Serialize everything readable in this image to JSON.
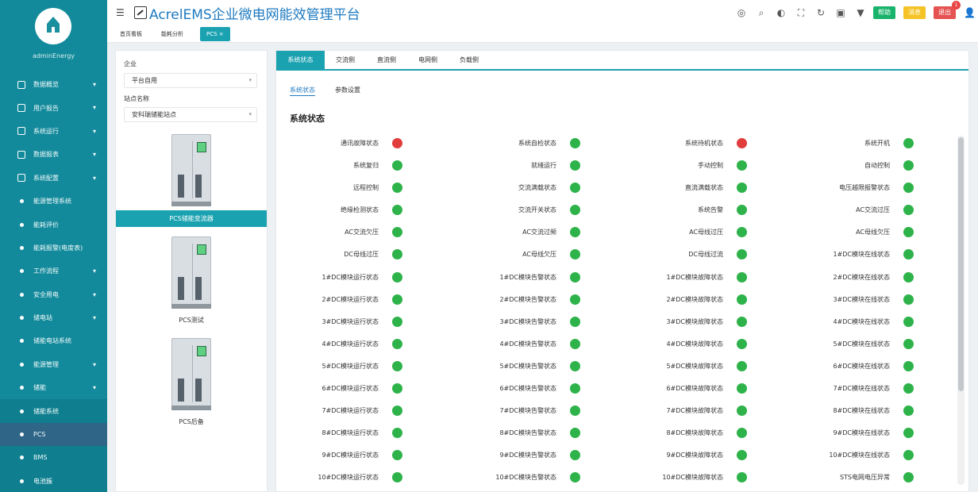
{
  "app": {
    "title": "AcrelEMS企业微电网能效管理平台"
  },
  "user": {
    "name": "adminEnergy"
  },
  "sidebar": {
    "items": [
      {
        "label": "数据概览",
        "level": 1,
        "arrow": "▾"
      },
      {
        "label": "用户报告",
        "level": 1,
        "arrow": "▾"
      },
      {
        "label": "系统运行",
        "level": 1,
        "arrow": "▾"
      },
      {
        "label": "数据报表",
        "level": 1,
        "arrow": "▾"
      },
      {
        "label": "系统配置",
        "level": 1,
        "arrow": "▾"
      },
      {
        "label": "能源管理系统",
        "level": 2,
        "arrow": ""
      },
      {
        "label": "能耗评价",
        "level": 2,
        "arrow": ""
      },
      {
        "label": "能耗报警(电度表)",
        "level": 2,
        "arrow": ""
      },
      {
        "label": "工作流程",
        "level": 2,
        "arrow": "▾"
      },
      {
        "label": "安全用电",
        "level": 2,
        "arrow": "▾"
      },
      {
        "label": "储电站",
        "level": 2,
        "arrow": "▾"
      },
      {
        "label": "储能电站系统",
        "level": 2,
        "arrow": ""
      },
      {
        "label": "能源管理",
        "level": 2,
        "arrow": "▾"
      },
      {
        "label": "储能",
        "level": 2,
        "arrow": "▾"
      },
      {
        "label": "储能系统",
        "level": 3,
        "arrow": ""
      },
      {
        "label": "PCS",
        "level": 3,
        "arrow": "",
        "active": true
      },
      {
        "label": "BMS",
        "level": 3,
        "arrow": ""
      },
      {
        "label": "电池簇",
        "level": 3,
        "arrow": ""
      }
    ]
  },
  "topbar": {
    "icons": [
      "monitor-icon",
      "search-icon",
      "volume-icon",
      "fullscreen-icon",
      "refresh-icon",
      "image-icon",
      "shirt-icon"
    ],
    "icon_glyphs": [
      "◎",
      "⌕",
      "◐",
      "⛶",
      "↻",
      "▣",
      "▼"
    ],
    "btn_green": "帮助",
    "btn_yellow": "消息",
    "btn_red": "退出",
    "badge": "1",
    "avatar_glyph": "👤"
  },
  "tabs": {
    "items": [
      "首页看板",
      "能耗分析",
      "PCS"
    ],
    "close": "×"
  },
  "left": {
    "enterprise_label": "企业",
    "enterprise_value": "平台自用",
    "station_label": "站点名称",
    "station_value": "安科瑞储能站点",
    "devices": [
      "PCS储能变流器",
      "PCS测试",
      "PCS后备"
    ]
  },
  "main": {
    "tabs": [
      "系统状态",
      "交流侧",
      "直流侧",
      "电网侧",
      "负载侧"
    ],
    "subtabs": [
      "系统状态",
      "参数设置"
    ],
    "section_title": "系统状态",
    "statuses": [
      {
        "label": "通讯故障状态",
        "status": "red"
      },
      {
        "label": "系统自检状态",
        "status": "green"
      },
      {
        "label": "系统待机状态",
        "status": "red"
      },
      {
        "label": "系统开机",
        "status": "green"
      },
      {
        "label": "系统复归",
        "status": "green"
      },
      {
        "label": "就绪运行",
        "status": "green"
      },
      {
        "label": "手动控制",
        "status": "green"
      },
      {
        "label": "自动控制",
        "status": "green"
      },
      {
        "label": "远程控制",
        "status": "green"
      },
      {
        "label": "交流满载状态",
        "status": "green"
      },
      {
        "label": "直流满载状态",
        "status": "green"
      },
      {
        "label": "电压越限报警状态",
        "status": "green"
      },
      {
        "label": "绝缘检测状态",
        "status": "green"
      },
      {
        "label": "交流开关状态",
        "status": "green"
      },
      {
        "label": "系统告警",
        "status": "green"
      },
      {
        "label": "AC交流过压",
        "status": "green"
      },
      {
        "label": "AC交流欠压",
        "status": "green"
      },
      {
        "label": "AC交流过频",
        "status": "green"
      },
      {
        "label": "AC母线过压",
        "status": "green"
      },
      {
        "label": "AC母线欠压",
        "status": "green"
      },
      {
        "label": "DC母线过压",
        "status": "green"
      },
      {
        "label": "AC母线欠压",
        "status": "green"
      },
      {
        "label": "DC母线过流",
        "status": "green"
      },
      {
        "label": "1#DC模块在线状态",
        "status": "green"
      },
      {
        "label": "1#DC模块运行状态",
        "status": "green"
      },
      {
        "label": "1#DC模块告警状态",
        "status": "green"
      },
      {
        "label": "1#DC模块故障状态",
        "status": "green"
      },
      {
        "label": "2#DC模块在线状态",
        "status": "green"
      },
      {
        "label": "2#DC模块运行状态",
        "status": "green"
      },
      {
        "label": "2#DC模块告警状态",
        "status": "green"
      },
      {
        "label": "2#DC模块故障状态",
        "status": "green"
      },
      {
        "label": "3#DC模块在线状态",
        "status": "green"
      },
      {
        "label": "3#DC模块运行状态",
        "status": "green"
      },
      {
        "label": "3#DC模块告警状态",
        "status": "green"
      },
      {
        "label": "3#DC模块故障状态",
        "status": "green"
      },
      {
        "label": "4#DC模块在线状态",
        "status": "green"
      },
      {
        "label": "4#DC模块运行状态",
        "status": "green"
      },
      {
        "label": "4#DC模块告警状态",
        "status": "green"
      },
      {
        "label": "4#DC模块故障状态",
        "status": "green"
      },
      {
        "label": "5#DC模块在线状态",
        "status": "green"
      },
      {
        "label": "5#DC模块运行状态",
        "status": "green"
      },
      {
        "label": "5#DC模块告警状态",
        "status": "green"
      },
      {
        "label": "5#DC模块故障状态",
        "status": "green"
      },
      {
        "label": "6#DC模块在线状态",
        "status": "green"
      },
      {
        "label": "6#DC模块运行状态",
        "status": "green"
      },
      {
        "label": "6#DC模块告警状态",
        "status": "green"
      },
      {
        "label": "6#DC模块故障状态",
        "status": "green"
      },
      {
        "label": "7#DC模块在线状态",
        "status": "green"
      },
      {
        "label": "7#DC模块运行状态",
        "status": "green"
      },
      {
        "label": "7#DC模块告警状态",
        "status": "green"
      },
      {
        "label": "7#DC模块故障状态",
        "status": "green"
      },
      {
        "label": "8#DC模块在线状态",
        "status": "green"
      },
      {
        "label": "8#DC模块运行状态",
        "status": "green"
      },
      {
        "label": "8#DC模块告警状态",
        "status": "green"
      },
      {
        "label": "8#DC模块故障状态",
        "status": "green"
      },
      {
        "label": "9#DC模块在线状态",
        "status": "green"
      },
      {
        "label": "9#DC模块运行状态",
        "status": "green"
      },
      {
        "label": "9#DC模块告警状态",
        "status": "green"
      },
      {
        "label": "9#DC模块故障状态",
        "status": "green"
      },
      {
        "label": "10#DC模块在线状态",
        "status": "green"
      },
      {
        "label": "10#DC模块运行状态",
        "status": "green"
      },
      {
        "label": "10#DC模块告警状态",
        "status": "green"
      },
      {
        "label": "10#DC模块故障状态",
        "status": "green"
      },
      {
        "label": "STS电网电压异常",
        "status": "green"
      }
    ]
  },
  "colors": {
    "accent": "#1aa2b1",
    "sidebar": "#138a9b",
    "ok": "#2eb34a",
    "fault": "#e23d3d",
    "title": "#1e7ac0"
  }
}
